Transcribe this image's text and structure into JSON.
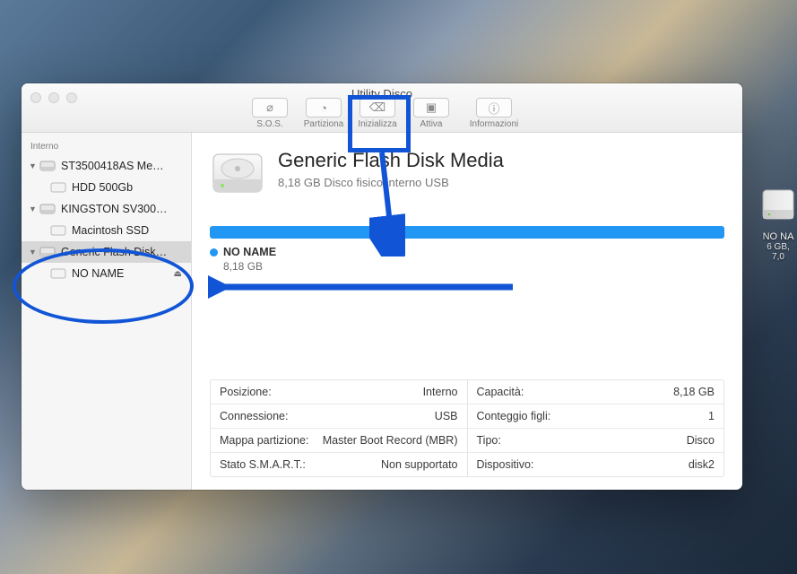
{
  "window": {
    "title": "Utility Disco"
  },
  "toolbar": {
    "sos": "S.O.S.",
    "partition": "Partiziona",
    "erase": "Inizializza",
    "mount": "Attiva",
    "info": "Informazioni"
  },
  "sidebar": {
    "section": "Interno",
    "disk0": {
      "name": "ST3500418AS Me…",
      "vol": "HDD 500Gb"
    },
    "disk1": {
      "name": "KINGSTON SV300…",
      "vol": "Macintosh SSD"
    },
    "disk2": {
      "name": "Generic Flash Disk…",
      "vol": "NO NAME"
    }
  },
  "main": {
    "title": "Generic Flash Disk Media",
    "subtitle": "8,18 GB Disco fisico interno USB",
    "legend_name": "NO NAME",
    "legend_size": "8,18 GB"
  },
  "info": {
    "left": [
      {
        "k": "Posizione:",
        "v": "Interno"
      },
      {
        "k": "Connessione:",
        "v": "USB"
      },
      {
        "k": "Mappa partizione:",
        "v": "Master Boot Record (MBR)"
      },
      {
        "k": "Stato S.M.A.R.T.:",
        "v": "Non supportato"
      }
    ],
    "right": [
      {
        "k": "Capacità:",
        "v": "8,18 GB"
      },
      {
        "k": "Conteggio figli:",
        "v": "1"
      },
      {
        "k": "Tipo:",
        "v": "Disco"
      },
      {
        "k": "Dispositivo:",
        "v": "disk2"
      }
    ]
  },
  "desktop_drive": {
    "name": "NO NA",
    "sub": "6 GB, 7,0"
  },
  "colors": {
    "accent": "#2196f3",
    "annotation": "#1155d6"
  }
}
